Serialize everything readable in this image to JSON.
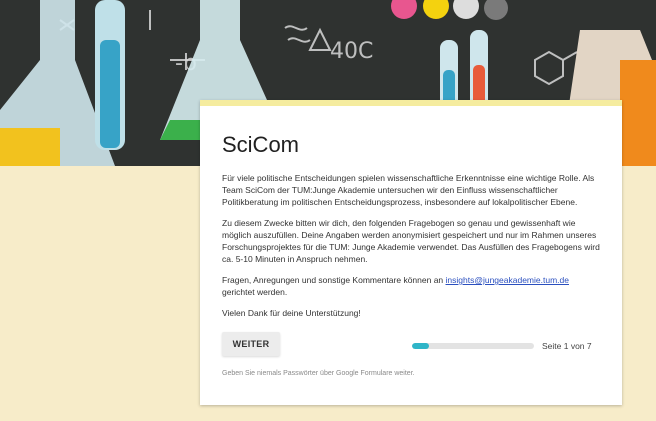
{
  "form": {
    "title": "SciCom",
    "paragraphs": {
      "p1": "Für viele politische Entscheidungen spielen wissenschaftliche Erkenntnisse eine wichtige Rolle. Als Team SciCom der TUM:Junge Akademie untersuchen wir den Einfluss wissenschaftlicher Politikberatung im politischen Entscheidungsprozess, insbesondere auf lokalpolitischer Ebene.",
      "p2": "Zu diesem Zwecke bitten wir dich, den folgenden Fragebogen so genau und gewissenhaft wie möglich auszufüllen. Deine Angaben werden  anonymisiert gespeichert und nur im Rahmen unseres Forschungsprojektes für die TUM: Junge Akademie verwendet. Das Ausfüllen des Fragebogens wird ca. 5-10 Minuten in Anspruch nehmen.",
      "p3_before": "Fragen, Anregungen und sonstige Kommentare können an ",
      "p3_email": "insights@jungeakademie.tum.de",
      "p3_after": "gerichtet werden.",
      "p4": "Vielen Dank für deine Unterstützung!"
    },
    "next_button": "WEITER",
    "progress": {
      "current": 1,
      "total": 7,
      "fraction": 0.143
    },
    "page_label": "Seite 1 von 7",
    "footer_note": "Geben Sie niemals Passwörter über Google Formulare weiter."
  },
  "colors": {
    "accent": "#2fb5c8",
    "card_top_border": "#f5ec9f",
    "page_background": "#f7ecc9",
    "header_background": "#2f3230",
    "link": "#2a4fbf"
  },
  "icons": {
    "header": "lab-glassware-illustration"
  }
}
